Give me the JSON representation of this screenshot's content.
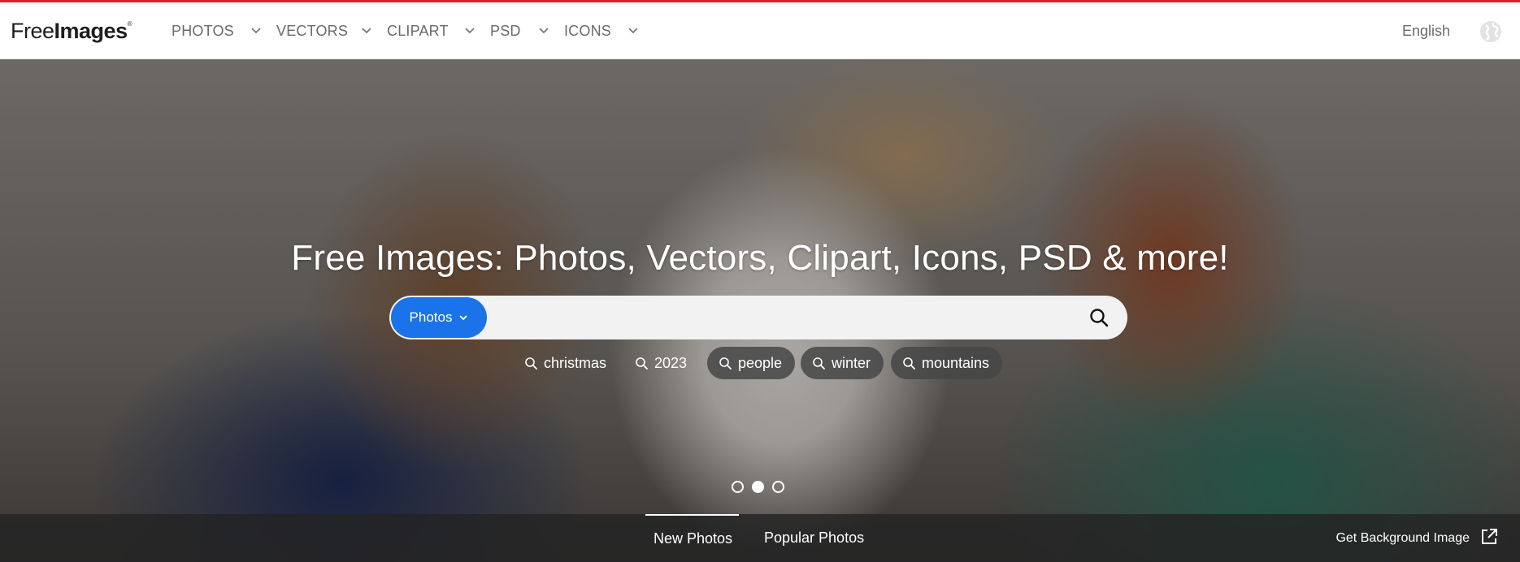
{
  "brand": {
    "logo_light": "Free",
    "logo_bold": "Images",
    "logo_mark": "®",
    "accent_color": "#d9232e",
    "primary_color": "#1a73e8"
  },
  "nav": {
    "items": [
      {
        "label": "PHOTOS",
        "icon": "chevron-down-icon"
      },
      {
        "label": "VECTORS",
        "icon": "chevron-down-icon"
      },
      {
        "label": "CLIPART",
        "icon": "chevron-down-icon"
      },
      {
        "label": "PSD",
        "icon": "chevron-down-icon"
      },
      {
        "label": "ICONS",
        "icon": "chevron-down-icon"
      }
    ],
    "language": "English",
    "language_icon": "globe-icon"
  },
  "hero": {
    "title": "Free Images: Photos, Vectors, Clipart, Icons, PSD & more!",
    "search": {
      "type_label": "Photos",
      "value": "",
      "placeholder": "",
      "button_icon": "search-icon"
    },
    "tags": [
      "christmas",
      "2023",
      "people",
      "winter",
      "mountains"
    ],
    "carousel": {
      "count": 3,
      "active_index": 1
    }
  },
  "bottom_bar": {
    "tabs": [
      {
        "label": "New Photos",
        "active": true
      },
      {
        "label": "Popular Photos",
        "active": false
      }
    ],
    "background_link": "Get Background Image",
    "background_icon": "external-link-icon"
  }
}
